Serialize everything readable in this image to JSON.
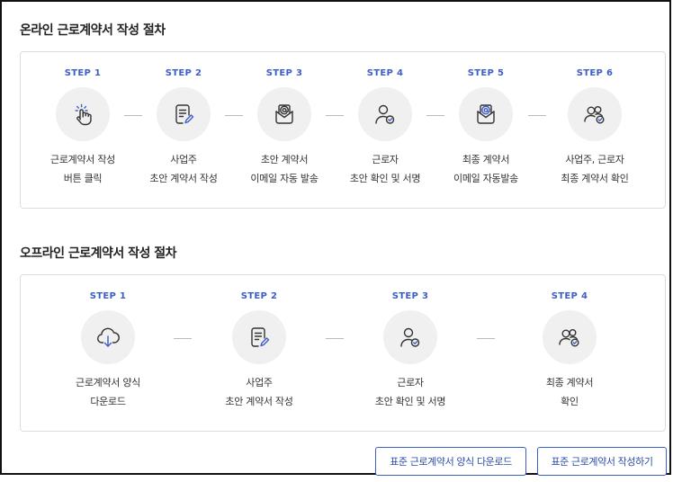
{
  "online": {
    "title": "온라인 근로계약서 작성 절차",
    "steps": [
      {
        "label": "STEP 1",
        "icon": "tap-icon",
        "line1": "근로계약서 작성",
        "line2": "버튼 클릭"
      },
      {
        "label": "STEP 2",
        "icon": "document-edit-icon",
        "line1": "사업주",
        "line2": "초안 계약서 작성"
      },
      {
        "label": "STEP 3",
        "icon": "email-icon",
        "line1": "초안 계약서",
        "line2": "이메일 자동 발송"
      },
      {
        "label": "STEP 4",
        "icon": "user-check-icon",
        "line1": "근로자",
        "line2": "초안 확인 및 서명"
      },
      {
        "label": "STEP 5",
        "icon": "email-icon",
        "line1": "최종 계약서",
        "line2": "이메일 자동발송"
      },
      {
        "label": "STEP 6",
        "icon": "users-check-icon",
        "line1": "사업주, 근로자",
        "line2": "최종 계약서 확인"
      }
    ]
  },
  "offline": {
    "title": "오프라인 근로계약서 작성 절차",
    "steps": [
      {
        "label": "STEP 1",
        "icon": "cloud-download-icon",
        "line1": "근로계약서 양식",
        "line2": "다운로드"
      },
      {
        "label": "STEP 2",
        "icon": "document-edit-icon",
        "line1": "사업주",
        "line2": "초안 계약서 작성"
      },
      {
        "label": "STEP 3",
        "icon": "user-check-icon",
        "line1": "근로자",
        "line2": "초안 확인 및 서명"
      },
      {
        "label": "STEP 4",
        "icon": "users-check-icon",
        "line1": "최종 계약서",
        "line2": "확인"
      }
    ]
  },
  "buttons": {
    "download": "표준 근로계약서 양식 다운로드",
    "write": "표준 근로계약서 작성하기"
  },
  "colors": {
    "accent": "#3d5fc4",
    "icon_bg": "#f0f0f0"
  }
}
